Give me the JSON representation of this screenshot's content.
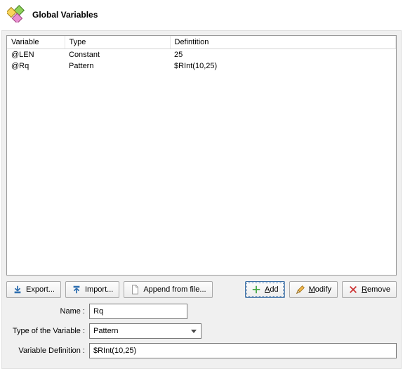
{
  "header": {
    "title": "Global Variables"
  },
  "table": {
    "columns": {
      "variable": "Variable",
      "type": "Type",
      "definition": "Defintition"
    },
    "rows": [
      {
        "variable": "@LEN",
        "type": "Constant",
        "definition": "25"
      },
      {
        "variable": "@Rq",
        "type": "Pattern",
        "definition": "$RInt(10,25)"
      }
    ]
  },
  "buttons": {
    "export": "Export...",
    "import": "Import...",
    "append": "Append from file...",
    "add_u": "A",
    "add_rest": "dd",
    "modify_u": "M",
    "modify_rest": "odify",
    "remove_u": "R",
    "remove_rest": "emove"
  },
  "form": {
    "name_label": "Name :",
    "name_value": "Rq",
    "type_label": "Type of the Variable :",
    "type_value": "Pattern",
    "def_label": "Variable Definition :",
    "def_value": "$RInt(10,25)"
  }
}
